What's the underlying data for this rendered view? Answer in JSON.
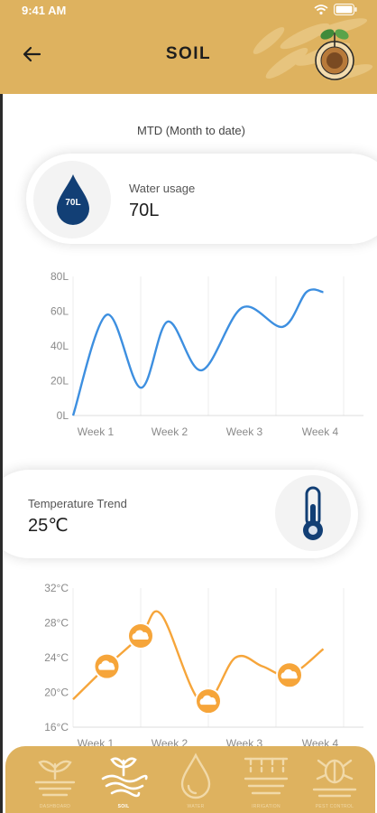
{
  "status": {
    "time": "9:41 AM"
  },
  "header": {
    "title": "SOIL"
  },
  "summary": {
    "period_label": "MTD (Month to date)",
    "water": {
      "label": "Water usage",
      "value": "70L",
      "badge": "70L"
    },
    "temperature": {
      "label": "Temperature Trend",
      "value": "25℃"
    }
  },
  "nav": {
    "items": [
      {
        "label": "DASHBOARD",
        "icon": "plant-soil-icon",
        "active": false
      },
      {
        "label": "SOIL",
        "icon": "soil-icon",
        "active": true
      },
      {
        "label": "WATER",
        "icon": "water-drop-icon",
        "active": false
      },
      {
        "label": "IRRIGATION",
        "icon": "irrigation-icon",
        "active": false
      },
      {
        "label": "PEST CONTROL",
        "icon": "pest-control-icon",
        "active": false
      }
    ]
  },
  "colors": {
    "header_bg": "#deb25f",
    "water_line": "#3d8fe0",
    "temp_line": "#f6a53a",
    "water_drop": "#123f75",
    "thermometer": "#123f75"
  },
  "chart_data": [
    {
      "type": "line",
      "categories": [
        "Week 1",
        "Week 2",
        "Week 3",
        "Week 4"
      ],
      "y_ticks": [
        "0L",
        "20L",
        "40L",
        "60L",
        "80L"
      ],
      "ylim": [
        0,
        80
      ],
      "grid": "vertical",
      "series": [
        {
          "x": [
            0,
            0.5,
            1.0,
            1.4,
            1.9,
            2.5,
            3.1,
            3.45,
            3.7
          ],
          "values": [
            0,
            58,
            16,
            54,
            26,
            62,
            51,
            71,
            71
          ]
        }
      ]
    },
    {
      "type": "line",
      "categories": [
        "Week 1",
        "Week 2",
        "Week 3",
        "Week 4"
      ],
      "y_ticks": [
        "16°C",
        "20°C",
        "24°C",
        "28°C",
        "32°C"
      ],
      "ylim": [
        16,
        32
      ],
      "grid": "vertical",
      "series": [
        {
          "x": [
            0,
            0.5,
            1.0,
            1.3,
            1.9,
            2.4,
            2.8,
            3.2,
            3.7
          ],
          "values": [
            19.2,
            23,
            26.5,
            29,
            18.8,
            24,
            23,
            22,
            25
          ]
        }
      ],
      "markers": [
        {
          "x": 0.5,
          "y": 23,
          "icon": "partly-cloudy-icon"
        },
        {
          "x": 1.0,
          "y": 26.5,
          "icon": "cloudy-icon"
        },
        {
          "x": 2.0,
          "y": 19,
          "icon": "cloud-icon"
        },
        {
          "x": 3.2,
          "y": 22,
          "icon": "rain-cloud-icon"
        }
      ]
    }
  ]
}
